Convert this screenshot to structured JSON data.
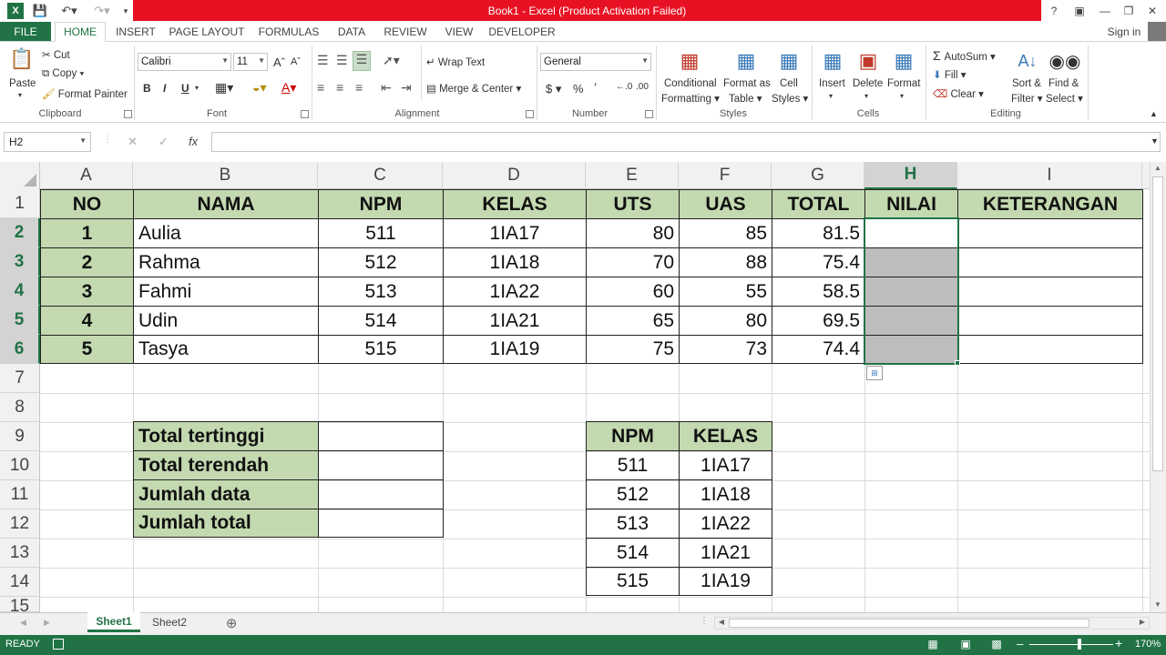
{
  "window": {
    "title": "Book1 -  Excel (Product Activation Failed)",
    "help": "?",
    "sign_in": "Sign in"
  },
  "tabs": [
    "FILE",
    "HOME",
    "INSERT",
    "PAGE LAYOUT",
    "FORMULAS",
    "DATA",
    "REVIEW",
    "VIEW",
    "DEVELOPER"
  ],
  "ribbon": {
    "clipboard": {
      "paste": "Paste",
      "cut": "Cut",
      "copy": "Copy",
      "format_painter": "Format Painter",
      "label": "Clipboard"
    },
    "font": {
      "name": "Calibri",
      "size": "11",
      "bold": "B",
      "italic": "I",
      "underline": "U",
      "label": "Font"
    },
    "alignment": {
      "wrap_text": "Wrap Text",
      "merge_center": "Merge & Center",
      "label": "Alignment"
    },
    "number": {
      "format": "General",
      "currency": "$",
      "percent": "%",
      "comma": "’",
      "label": "Number"
    },
    "styles": {
      "conditional_1": "Conditional",
      "conditional_2": "Formatting",
      "format_table_1": "Format as",
      "format_table_2": "Table",
      "cell_styles_1": "Cell",
      "cell_styles_2": "Styles",
      "label": "Styles"
    },
    "cells": {
      "insert": "Insert",
      "delete": "Delete",
      "format": "Format",
      "label": "Cells"
    },
    "editing": {
      "autosum": "AutoSum",
      "fill": "Fill",
      "clear": "Clear",
      "sort_1": "Sort &",
      "sort_2": "Filter",
      "find_1": "Find &",
      "find_2": "Select",
      "label": "Editing"
    }
  },
  "formula_bar": {
    "name_box": "H2",
    "cancel": "✕",
    "enter": "✓",
    "fx": "fx",
    "value": ""
  },
  "columns": [
    "A",
    "B",
    "C",
    "D",
    "E",
    "F",
    "G",
    "H",
    "I"
  ],
  "rows": [
    "1",
    "2",
    "3",
    "4",
    "5",
    "6",
    "7",
    "8",
    "9",
    "10",
    "11",
    "12",
    "13",
    "14",
    "15"
  ],
  "main_table": {
    "headers": [
      "NO",
      "NAMA",
      "NPM",
      "KELAS",
      "UTS",
      "UAS",
      "TOTAL",
      "NILAI",
      "KETERANGAN"
    ],
    "rows": [
      [
        "1",
        "Aulia",
        "511",
        "1IA17",
        "80",
        "85",
        "81.5",
        "",
        ""
      ],
      [
        "2",
        "Rahma",
        "512",
        "1IA18",
        "70",
        "88",
        "75.4",
        "",
        ""
      ],
      [
        "3",
        "Fahmi",
        "513",
        "1IA22",
        "60",
        "55",
        "58.5",
        "",
        ""
      ],
      [
        "4",
        "Udin",
        "514",
        "1IA21",
        "65",
        "80",
        "69.5",
        "",
        ""
      ],
      [
        "5",
        "Tasya",
        "515",
        "1IA19",
        "75",
        "73",
        "74.4",
        "",
        ""
      ]
    ]
  },
  "summary_table": {
    "labels": [
      "Total tertinggi",
      "Total terendah",
      "Jumlah data",
      "Jumlah total"
    ]
  },
  "lookup_table": {
    "headers": [
      "NPM",
      "KELAS"
    ],
    "rows": [
      [
        "511",
        "1IA17"
      ],
      [
        "512",
        "1IA18"
      ],
      [
        "513",
        "1IA22"
      ],
      [
        "514",
        "1IA21"
      ],
      [
        "515",
        "1IA19"
      ]
    ]
  },
  "sheets": {
    "tabs": [
      "Sheet1",
      "Sheet2"
    ],
    "active": "Sheet1",
    "add": "⊕"
  },
  "status": {
    "ready": "READY",
    "zoom": "170%"
  },
  "colors": {
    "excel_green": "#217346",
    "header_fill": "#c3d9b0",
    "title_red": "#e81123",
    "selection_gray": "#bdbdbd"
  }
}
